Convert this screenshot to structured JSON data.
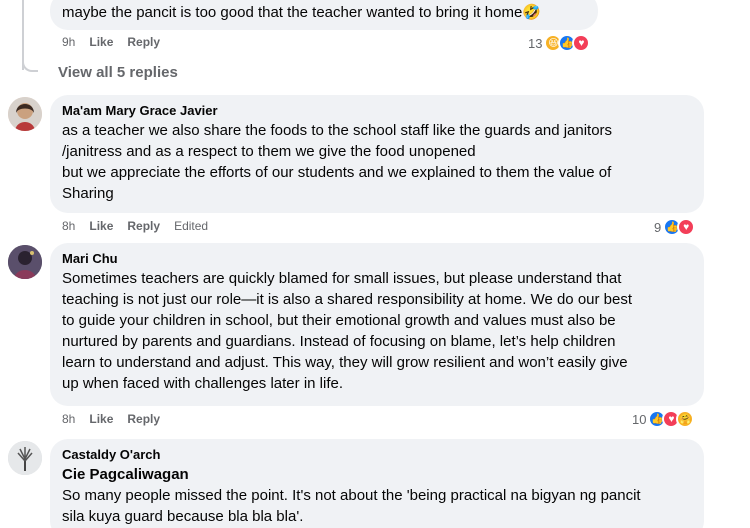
{
  "comment0": {
    "text": "maybe the pancit is too good that the teacher wanted to bring it home🤣",
    "time": "9h",
    "like": "Like",
    "reply": "Reply",
    "count": "13"
  },
  "view_replies": "View all 5 replies",
  "comment1": {
    "author": "Ma'am Mary Grace Javier",
    "text": "as a teacher we also share the foods to the school staff like the guards and janitors\n/janitress and as a respect to them we give the food unopened\nbut we appreciate the efforts of our students and we explained to them the value of\nSharing",
    "time": "8h",
    "like": "Like",
    "reply": "Reply",
    "edited": "Edited",
    "count": "9"
  },
  "comment2": {
    "author": "Mari Chu",
    "text": "Sometimes teachers are quickly blamed for small issues, but please understand that\nteaching is not just our role—it is also a shared responsibility at home. We do our best\nto guide your children in school, but their emotional growth and values must also be\nnurtured by parents and guardians. Instead of focusing on blame, let’s help children\nlearn to understand and adjust. This way, they will grow resilient and won’t easily give\nup when faced with challenges later in life.",
    "time": "8h",
    "like": "Like",
    "reply": "Reply",
    "count": "10"
  },
  "comment3": {
    "author": "Castaldy O'arch",
    "tag": "Cie Pagcaliwagan",
    "text": "So many people missed the point. It's not about the 'being practical na bigyan ng pancit\nsila kuya guard because bla bla bla'."
  },
  "colors": {
    "like": "#1877f2",
    "love": "#f33e58",
    "haha": "#f7b125",
    "bubble": "#f0f2f5",
    "meta": "#65676b"
  },
  "icons": [
    "like-reaction-icon",
    "love-reaction-icon",
    "haha-reaction-icon",
    "care-reaction-icon"
  ]
}
